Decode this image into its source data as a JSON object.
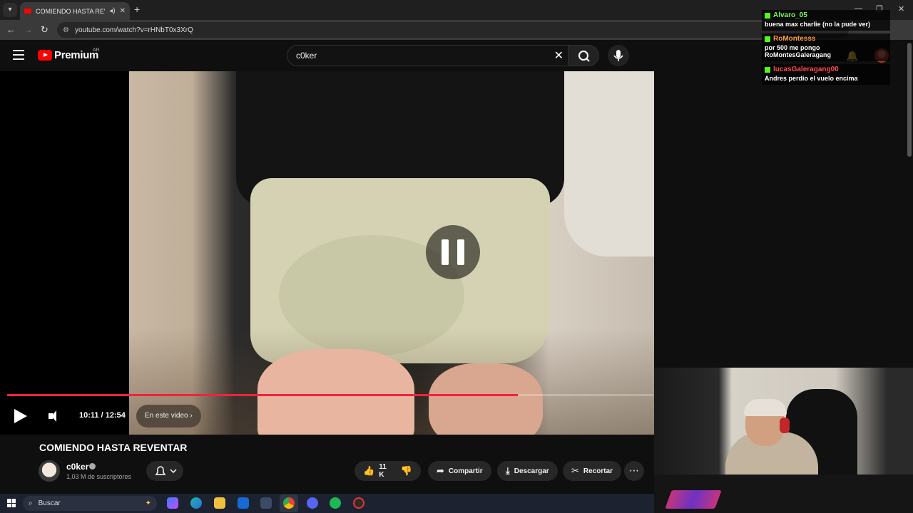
{
  "browser": {
    "tab_title": "COMIENDO HASTA REVENTAR",
    "new_tab_glyph": "+",
    "url": "youtube.com/watch?v=rHNbT0x3XrQ"
  },
  "youtube": {
    "logo_text": "Premium",
    "country": "AR",
    "search_value": "c0ker"
  },
  "player": {
    "time": "10:11 / 12:54",
    "progress": 0.79,
    "chapter_label": "En este video  ›"
  },
  "video": {
    "title": "COMIENDO HASTA REVENTAR",
    "channel": "c0ker",
    "subscribers": "1,03 M de suscriptores",
    "likes": "11 K",
    "share": "Compartir",
    "download": "Descargar",
    "clip": "Recortar"
  },
  "chat": [
    {
      "user": "Alvaro_05",
      "color": "#7cfc5c",
      "text": "buena max charlie (no la pude ver)"
    },
    {
      "user": "RoMontesss",
      "color": "#ff9b3d",
      "text": "por 500 me pongo RoMontesGaleragang"
    },
    {
      "user": "lucasGaleragang00",
      "color": "#ff4a4a",
      "text": "Andres perdio el vuelo encima"
    }
  ],
  "taskbar": {
    "search_label": "Buscar"
  },
  "colors": {
    "accent": "#ff0000",
    "progress": "#f0233c"
  }
}
